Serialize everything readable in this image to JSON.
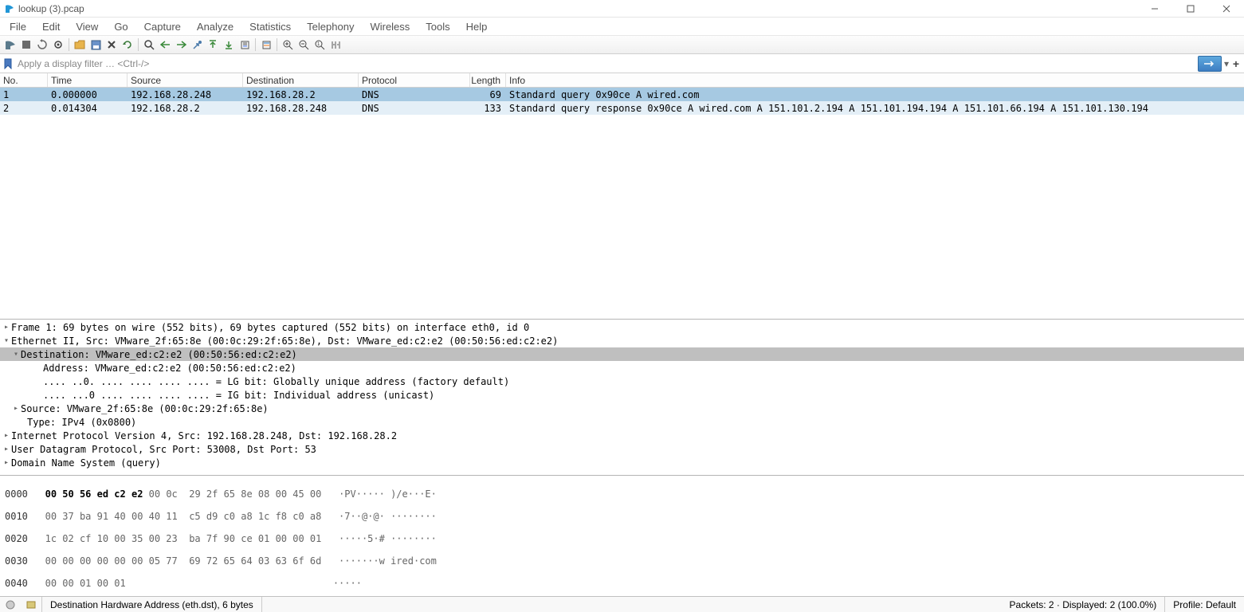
{
  "title": "lookup (3).pcap",
  "menu": [
    "File",
    "Edit",
    "View",
    "Go",
    "Capture",
    "Analyze",
    "Statistics",
    "Telephony",
    "Wireless",
    "Tools",
    "Help"
  ],
  "filter": {
    "placeholder": "Apply a display filter … <Ctrl-/>"
  },
  "columns": {
    "no": "No.",
    "time": "Time",
    "src": "Source",
    "dst": "Destination",
    "proto": "Protocol",
    "len": "Length",
    "info": "Info"
  },
  "packets": [
    {
      "no": "1",
      "time": "0.000000",
      "src": "192.168.28.248",
      "dst": "192.168.28.2",
      "proto": "DNS",
      "len": "69",
      "info": "Standard query 0x90ce A wired.com",
      "sel": true
    },
    {
      "no": "2",
      "time": "0.014304",
      "src": "192.168.28.2",
      "dst": "192.168.28.248",
      "proto": "DNS",
      "len": "133",
      "info": "Standard query response 0x90ce A wired.com A 151.101.2.194 A 151.101.194.194 A 151.101.66.194 A 151.101.130.194",
      "resp": true
    }
  ],
  "details": {
    "frame": "Frame 1: 69 bytes on wire (552 bits), 69 bytes captured (552 bits) on interface eth0, id 0",
    "eth": "Ethernet II, Src: VMware_2f:65:8e (00:0c:29:2f:65:8e), Dst: VMware_ed:c2:e2 (00:50:56:ed:c2:e2)",
    "dest": "Destination: VMware_ed:c2:e2 (00:50:56:ed:c2:e2)",
    "addr": "Address: VMware_ed:c2:e2 (00:50:56:ed:c2:e2)",
    "lg": ".... ..0. .... .... .... .... = LG bit: Globally unique address (factory default)",
    "ig": ".... ...0 .... .... .... .... = IG bit: Individual address (unicast)",
    "src": "Source: VMware_2f:65:8e (00:0c:29:2f:65:8e)",
    "type": "Type: IPv4 (0x0800)",
    "ip": "Internet Protocol Version 4, Src: 192.168.28.248, Dst: 192.168.28.2",
    "udp": "User Datagram Protocol, Src Port: 53008, Dst Port: 53",
    "dns": "Domain Name System (query)"
  },
  "hex": {
    "r0": {
      "addr": "0000",
      "b1": "00 50 56 ed c2 e2",
      "b2": " 00 0c  29 2f 65 8e 08 00 45 00",
      "a": "   ·PV····· )/e···E·"
    },
    "r1": {
      "addr": "0010",
      "b": "00 37 ba 91 40 00 40 11  c5 d9 c0 a8 1c f8 c0 a8",
      "a": "   ·7··@·@· ········"
    },
    "r2": {
      "addr": "0020",
      "b": "1c 02 cf 10 00 35 00 23  ba 7f 90 ce 01 00 00 01",
      "a": "   ·····5·# ········"
    },
    "r3": {
      "addr": "0030",
      "b": "00 00 00 00 00 00 05 77  69 72 65 64 03 63 6f 6d",
      "a": "   ·······w ired·com"
    },
    "r4": {
      "addr": "0040",
      "b": "00 00 01 00 01",
      "a": "                                    ·····"
    }
  },
  "status": {
    "field": "Destination Hardware Address (eth.dst), 6 bytes",
    "packets": "Packets: 2 · Displayed: 2 (100.0%)",
    "profile": "Profile: Default"
  }
}
